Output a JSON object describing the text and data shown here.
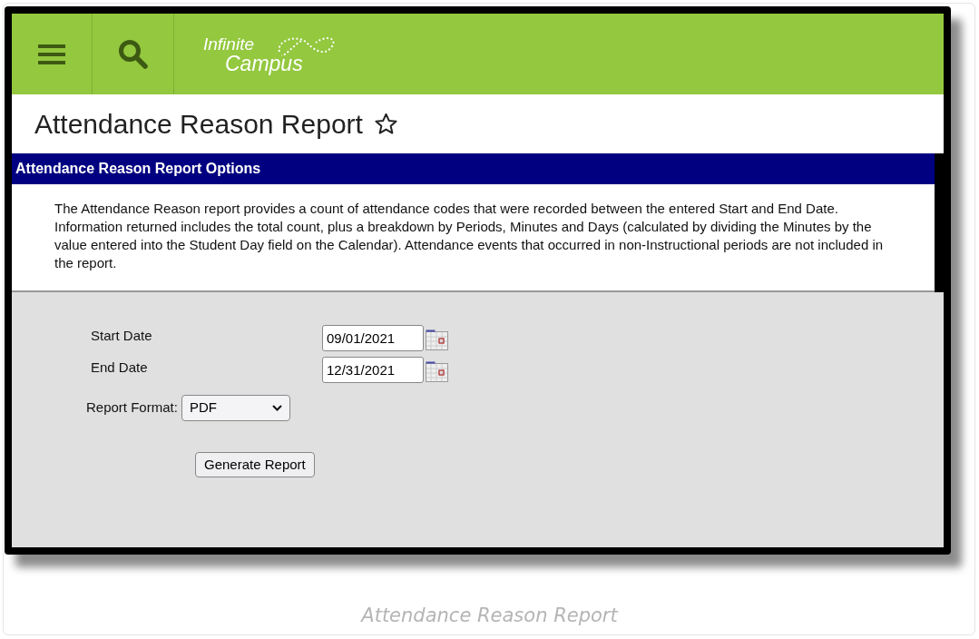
{
  "header": {
    "logo_lines": [
      "Infinite",
      "Campus"
    ]
  },
  "page_title": "Attendance Reason Report",
  "favorite": {
    "selected": false
  },
  "section": {
    "title": "Attendance Reason Report Options",
    "description": "The Attendance Reason report provides a count of attendance codes that were recorded between the entered Start and End Date. Information returned includes the total count, plus a breakdown by Periods, Minutes and Days (calculated by dividing the Minutes by the value entered into the Student Day field on the Calendar). Attendance events that occurred in non-Instructional periods are not included in the report."
  },
  "date_fields": [
    {
      "label": "Start Date",
      "value": "09/01/2021"
    },
    {
      "label": "End Date",
      "value": "12/31/2021"
    }
  ],
  "report_format": {
    "label": "Report Format:",
    "value": "PDF"
  },
  "buttons": [
    "Generate Report"
  ],
  "caption": "Attendance Reason Report"
}
